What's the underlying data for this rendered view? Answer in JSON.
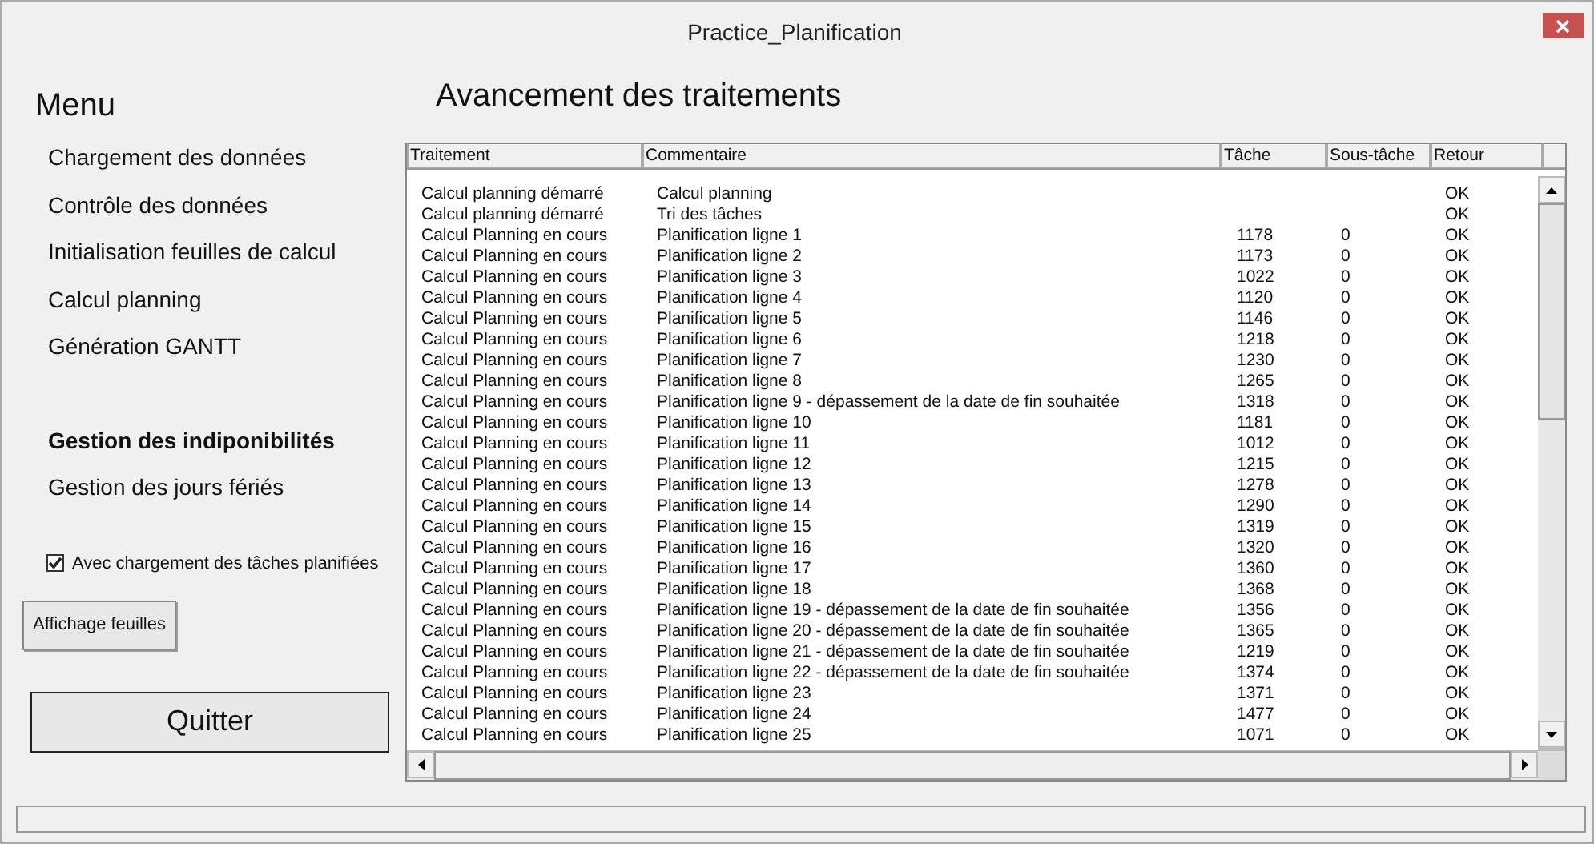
{
  "window": {
    "title": "Practice_Planification"
  },
  "sidebar": {
    "title": "Menu",
    "items": [
      {
        "label": "Chargement des données",
        "emphasized": false
      },
      {
        "label": "Contrôle des données",
        "emphasized": false
      },
      {
        "label": "Initialisation feuilles de calcul",
        "emphasized": false
      },
      {
        "label": "Calcul planning",
        "emphasized": false
      },
      {
        "label": "Génération GANTT",
        "emphasized": false
      },
      {
        "label": "Gestion des indiponibilités",
        "emphasized": true
      },
      {
        "label": "Gestion des jours fériés",
        "emphasized": false
      }
    ],
    "checkbox": {
      "label": "Avec chargement des tâches planifiées",
      "checked": true
    },
    "buttons": [
      "Affichage feuilles",
      "Quitter"
    ]
  },
  "main": {
    "title": "Avancement des traitements",
    "table": {
      "columns": [
        "Traitement",
        "Commentaire",
        "Tâche",
        "Sous-tâche",
        "Retour"
      ],
      "rows": [
        [
          "Calcul planning démarré",
          "Calcul planning",
          "",
          "",
          "OK"
        ],
        [
          "Calcul planning démarré",
          "Tri des tâches",
          "",
          "",
          "OK"
        ],
        [
          "Calcul Planning en cours",
          "Planification ligne 1",
          "1178",
          "0",
          "OK"
        ],
        [
          "Calcul Planning en cours",
          "Planification ligne 2",
          "1173",
          "0",
          "OK"
        ],
        [
          "Calcul Planning en cours",
          "Planification ligne 3",
          "1022",
          "0",
          "OK"
        ],
        [
          "Calcul Planning en cours",
          "Planification ligne 4",
          "1120",
          "0",
          "OK"
        ],
        [
          "Calcul Planning en cours",
          "Planification ligne 5",
          "1146",
          "0",
          "OK"
        ],
        [
          "Calcul Planning en cours",
          "Planification ligne 6",
          "1218",
          "0",
          "OK"
        ],
        [
          "Calcul Planning en cours",
          "Planification ligne 7",
          "1230",
          "0",
          "OK"
        ],
        [
          "Calcul Planning en cours",
          "Planification ligne 8",
          "1265",
          "0",
          "OK"
        ],
        [
          "Calcul Planning en cours",
          "Planification ligne 9 - dépassement de la date de fin souhaitée",
          "1318",
          "0",
          "OK"
        ],
        [
          "Calcul Planning en cours",
          "Planification ligne 10",
          "1181",
          "0",
          "OK"
        ],
        [
          "Calcul Planning en cours",
          "Planification ligne 11",
          "1012",
          "0",
          "OK"
        ],
        [
          "Calcul Planning en cours",
          "Planification ligne 12",
          "1215",
          "0",
          "OK"
        ],
        [
          "Calcul Planning en cours",
          "Planification ligne 13",
          "1278",
          "0",
          "OK"
        ],
        [
          "Calcul Planning en cours",
          "Planification ligne 14",
          "1290",
          "0",
          "OK"
        ],
        [
          "Calcul Planning en cours",
          "Planification ligne 15",
          "1319",
          "0",
          "OK"
        ],
        [
          "Calcul Planning en cours",
          "Planification ligne 16",
          "1320",
          "0",
          "OK"
        ],
        [
          "Calcul Planning en cours",
          "Planification ligne 17",
          "1360",
          "0",
          "OK"
        ],
        [
          "Calcul Planning en cours",
          "Planification ligne 18",
          "1368",
          "0",
          "OK"
        ],
        [
          "Calcul Planning en cours",
          "Planification ligne 19 - dépassement de la date de fin souhaitée",
          "1356",
          "0",
          "OK"
        ],
        [
          "Calcul Planning en cours",
          "Planification ligne 20 - dépassement de la date de fin souhaitée",
          "1365",
          "0",
          "OK"
        ],
        [
          "Calcul Planning en cours",
          "Planification ligne 21 - dépassement de la date de fin souhaitée",
          "1219",
          "0",
          "OK"
        ],
        [
          "Calcul Planning en cours",
          "Planification ligne 22 - dépassement de la date de fin souhaitée",
          "1374",
          "0",
          "OK"
        ],
        [
          "Calcul Planning en cours",
          "Planification ligne 23",
          "1371",
          "0",
          "OK"
        ],
        [
          "Calcul Planning en cours",
          "Planification ligne 24",
          "1477",
          "0",
          "OK"
        ],
        [
          "Calcul Planning en cours",
          "Planification ligne 25",
          "1071",
          "0",
          "OK"
        ]
      ]
    }
  }
}
